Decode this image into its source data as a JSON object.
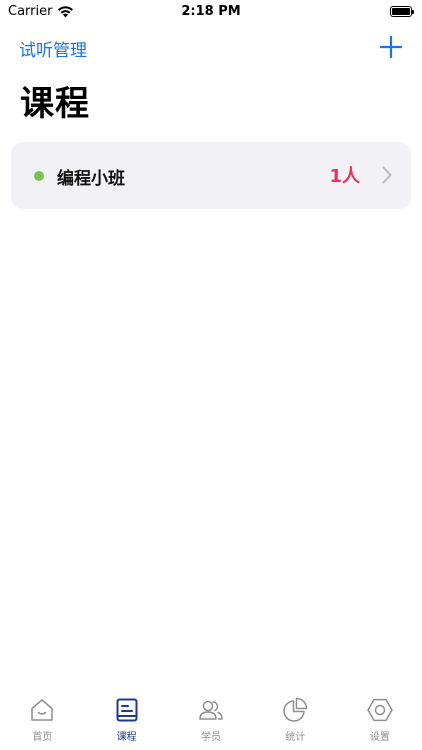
{
  "status_bar": {
    "carrier": "Carrier",
    "time": "2:18 PM",
    "battery_level": 1.0
  },
  "nav": {
    "back_title": "试听管理",
    "add_icon": "plus-icon"
  },
  "page": {
    "title": "课程"
  },
  "courses": [
    {
      "name": "编程小班",
      "count": "1人",
      "status_color": "#7cc156",
      "count_color": "#e8335a"
    }
  ],
  "tab_bar": {
    "active_index": 1,
    "active_color": "#1e3a8a",
    "inactive_color": "#8e8e93",
    "tabs": [
      {
        "label": "首页",
        "icon": "home-icon"
      },
      {
        "label": "课程",
        "icon": "course-book-icon"
      },
      {
        "label": "学员",
        "icon": "students-icon"
      },
      {
        "label": "统计",
        "icon": "pie-chart-icon"
      },
      {
        "label": "设置",
        "icon": "settings-icon"
      }
    ]
  },
  "colors": {
    "accent": "#1a73e8",
    "card_background": "#f2f2f6"
  }
}
